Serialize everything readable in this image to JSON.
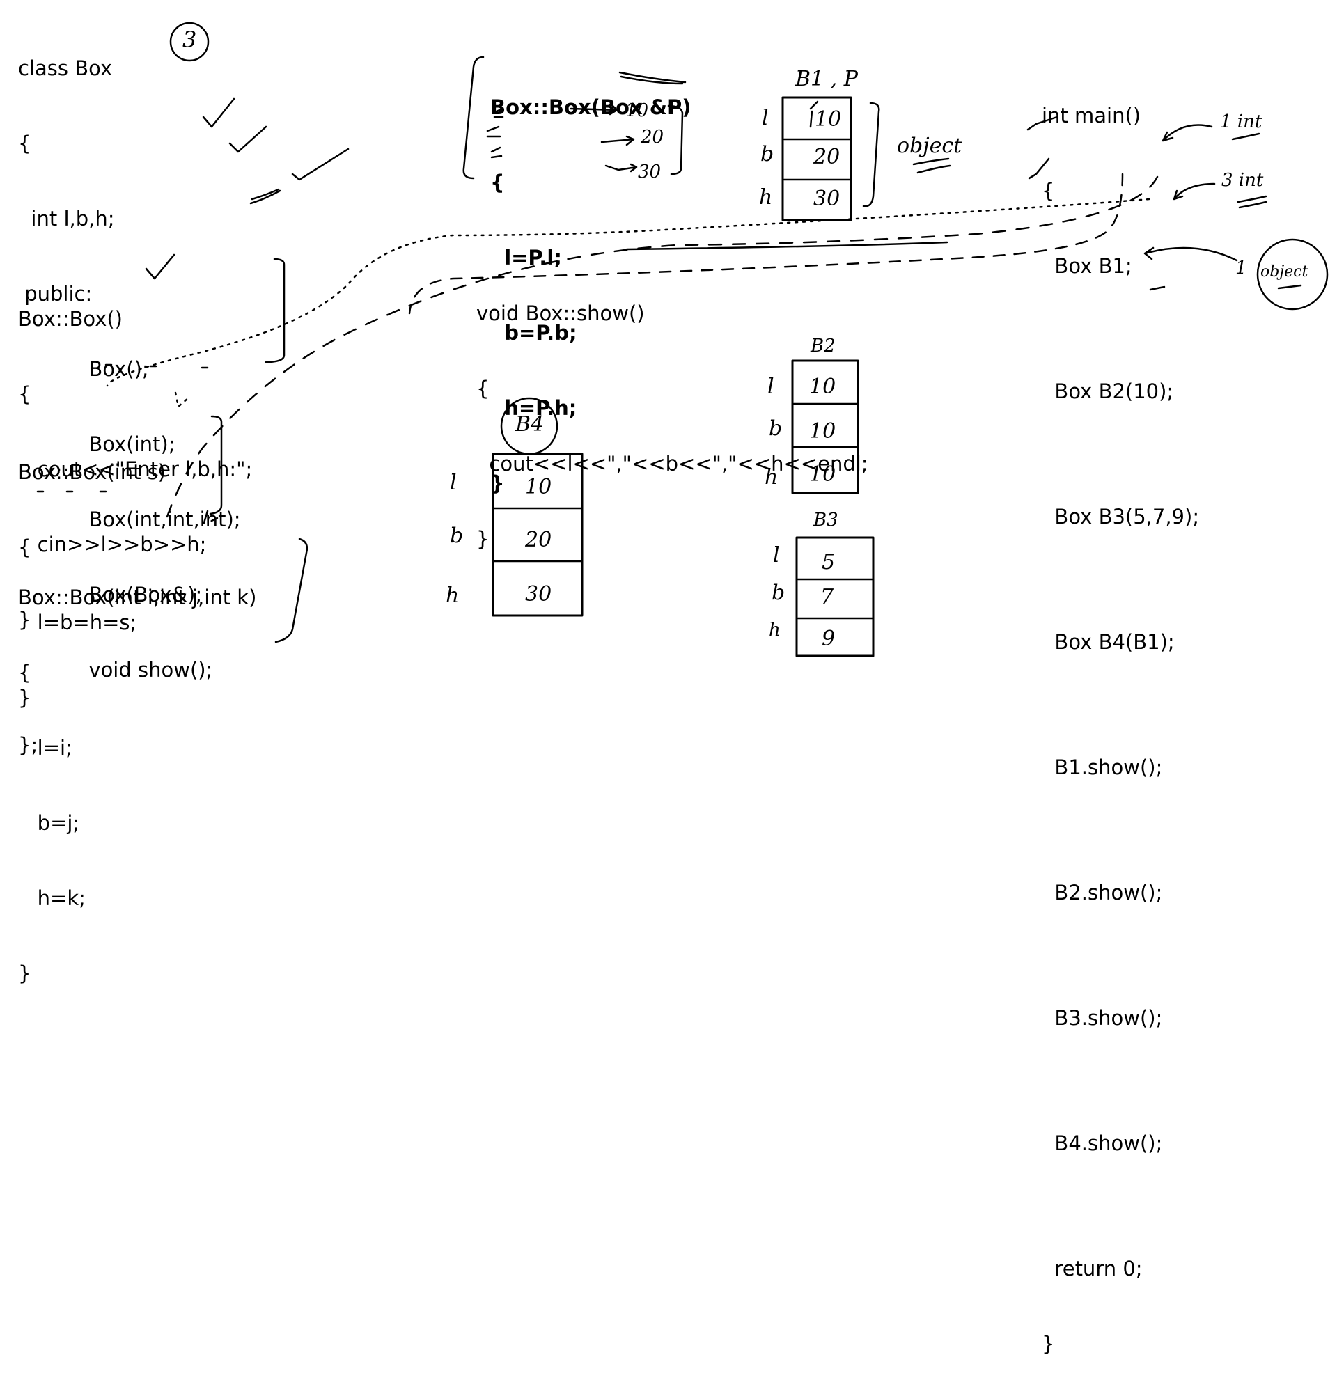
{
  "class_block": {
    "lines": [
      "class Box",
      "{",
      "  int l,b,h;",
      " public:",
      "           Box();",
      "           Box(int);",
      "           Box(int,int,int);",
      "           Box(Box&);",
      "           void show();",
      "};"
    ],
    "circle_note": "3"
  },
  "default_ctor": {
    "lines": [
      "Box::Box()",
      "{",
      "   cout<<\"Enter l,b,h:\";",
      "   cin>>l>>b>>h;",
      "}"
    ]
  },
  "one_param_ctor": {
    "lines": [
      "Box::Box(int s)",
      "{",
      "   l=b=h=s;",
      "}"
    ]
  },
  "three_param_ctor": {
    "lines": [
      "Box::Box(int i,int j,int k)",
      "{",
      "   l=i;",
      "   b=j;",
      "   h=k;",
      "}"
    ]
  },
  "copy_ctor": {
    "lines": [
      "Box::Box(Box &P)",
      "{",
      "  l=P.l;",
      "  b=P.b;",
      "  h=P.h;",
      "}"
    ],
    "arrow_values": [
      "10",
      "20",
      "30"
    ]
  },
  "show_fn": {
    "lines": [
      "void Box::show()",
      "{",
      "  cout<<l<<\",\"<<b<<\",\"<<h<<endl;",
      "}"
    ]
  },
  "main_fn": {
    "lines": [
      "int main()",
      "{",
      "  Box B1;",
      "",
      "  Box B2(10);",
      "",
      "  Box B3(5,7,9);",
      "",
      "  Box B4(B1);",
      "",
      "  B1.show();",
      "",
      "  B2.show();",
      "",
      "  B3.show();",
      "",
      "  B4.show();",
      "",
      "  return 0;",
      "}"
    ],
    "notes": [
      "1 int",
      "3 int",
      "1",
      "object"
    ]
  },
  "memory_boxes": {
    "b1_p": {
      "title": "B1 , P",
      "labels": [
        "l",
        "b",
        "h"
      ],
      "values": [
        "10",
        "20",
        "30"
      ],
      "side_note": "object"
    },
    "b2": {
      "title": "B2",
      "labels": [
        "l",
        "b",
        "h"
      ],
      "values": [
        "10",
        "10",
        "10"
      ]
    },
    "b3": {
      "title": "B3",
      "labels": [
        "l",
        "b",
        "h"
      ],
      "values": [
        "5",
        "7",
        "9"
      ]
    },
    "b4": {
      "title": "B4",
      "labels": [
        "l",
        "b",
        "h"
      ],
      "values": [
        "10",
        "20",
        "30"
      ]
    }
  }
}
